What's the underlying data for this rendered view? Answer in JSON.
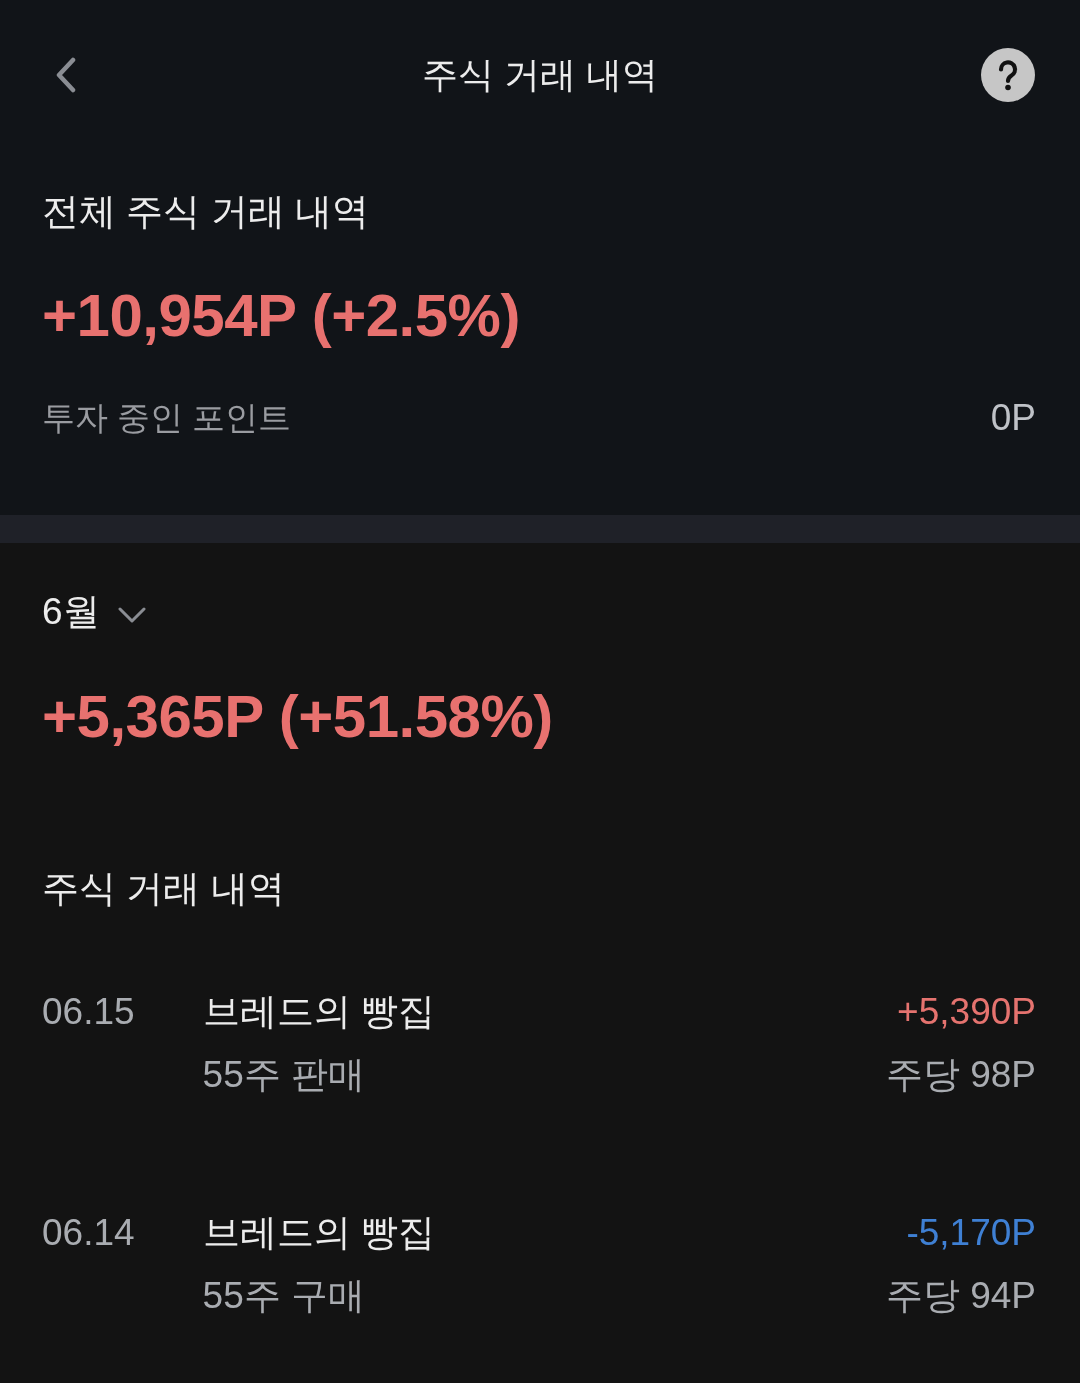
{
  "header": {
    "title": "주식 거래 내역"
  },
  "summary": {
    "title": "전체 주식 거래 내역",
    "total": "+10,954P (+2.5%)",
    "invested_label": "투자 중인 포인트",
    "invested_value": "0P"
  },
  "month": {
    "label": "6월",
    "total": "+5,365P (+51.58%)"
  },
  "history": {
    "title": "주식 거래 내역",
    "transactions": [
      {
        "date": "06.15",
        "name": "브레드의 빵집",
        "detail": "55주 판매",
        "amount": "+5,390P",
        "color": "#e5736f",
        "unit_price": "주당 98P"
      },
      {
        "date": "06.14",
        "name": "브레드의 빵집",
        "detail": "55주 구매",
        "amount": "-5,170P",
        "color": "#3f80d4",
        "unit_price": "주당 94P"
      }
    ]
  }
}
